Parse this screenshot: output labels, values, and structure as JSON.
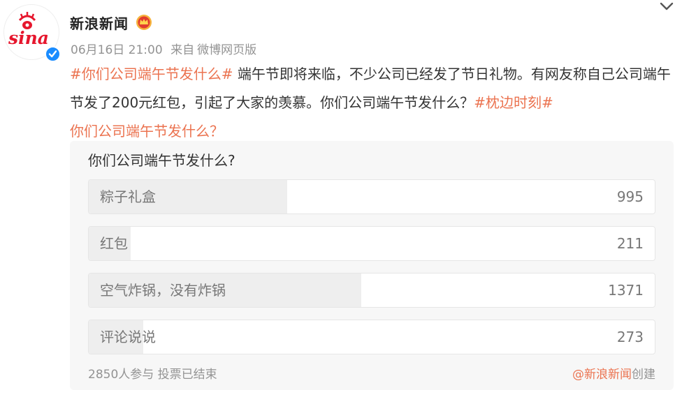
{
  "post": {
    "author": "新浪新闻",
    "time": "06月16日 21:00",
    "source_prefix": "来自",
    "source": "微博网页版",
    "content": {
      "tag1": "#你们公司端午节发什么#",
      "text": " 端午节即将来临，不少公司已经发了节日礼物。有网友称自己公司端午节发了200元红包，引起了大家的羡慕。你们公司端午节发什么？",
      "tag2": "#枕边时刻#",
      "trailing": "你们公司端午节发什么？"
    }
  },
  "icons": {
    "avatar": "sina-logo-icon",
    "verified": "verified-badge-icon",
    "crown": "crown-icon",
    "more": "chevron-down-icon"
  },
  "colors": {
    "accent": "#eb7350",
    "verified": "#1a8cff",
    "logo_red": "#e6162d",
    "poll_bg": "#f7f7f7",
    "bar_fill": "#eeeeee"
  },
  "poll": {
    "title": "你们公司端午节发什么?",
    "options": [
      {
        "label": "粽子礼盒",
        "count": "995",
        "fraction": 0.351
      },
      {
        "label": "红包",
        "count": "211",
        "fraction": 0.074
      },
      {
        "label": "空气炸锅，没有炸锅",
        "count": "1371",
        "fraction": 0.481
      },
      {
        "label": "评论说说",
        "count": "273",
        "fraction": 0.096
      }
    ],
    "participants": "2850人参与",
    "status": "投票已结束",
    "creator": "@新浪新闻",
    "creator_suffix": "创建"
  }
}
